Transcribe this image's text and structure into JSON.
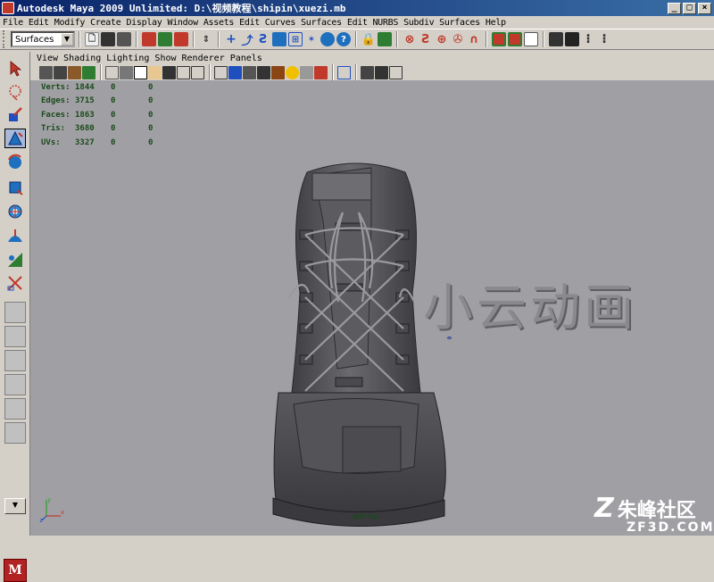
{
  "window": {
    "title": "Autodesk Maya 2009 Unlimited: D:\\视频教程\\shipin\\xuezi.mb",
    "minimize": "_",
    "maximize": "□",
    "close": "×"
  },
  "menubar": [
    "File",
    "Edit",
    "Modify",
    "Create",
    "Display",
    "Window",
    "Assets",
    "Edit Curves",
    "Surfaces",
    "Edit NURBS",
    "Subdiv Surfaces",
    "Help"
  ],
  "statusline": {
    "menu_set": "Surfaces"
  },
  "panel_menu": [
    "View",
    "Shading",
    "Lighting",
    "Show",
    "Renderer",
    "Panels"
  ],
  "hud": {
    "rows": [
      {
        "label": "Verts:",
        "v1": "1844",
        "v2": "0",
        "v3": "0"
      },
      {
        "label": "Edges:",
        "v1": "3715",
        "v2": "0",
        "v3": "0"
      },
      {
        "label": "Faces:",
        "v1": "1863",
        "v2": "0",
        "v3": "0"
      },
      {
        "label": "Tris:",
        "v1": "3680",
        "v2": "0",
        "v3": "0"
      },
      {
        "label": "UVs:",
        "v1": "3327",
        "v2": "0",
        "v3": "0"
      }
    ]
  },
  "viewport": {
    "camera": "persp",
    "background": "#a0a0a4"
  },
  "watermark": "小云动画",
  "corner_logo": {
    "zh": "朱峰社区",
    "domain": "ZF3D.COM"
  },
  "axis": {
    "x": "x",
    "y": "y",
    "z": "z"
  },
  "colors": {
    "title_gradient_start": "#0a246a",
    "title_gradient_end": "#3a6ea5",
    "ui_gray": "#d4d0c8",
    "hud_text": "#1a4a1a"
  }
}
